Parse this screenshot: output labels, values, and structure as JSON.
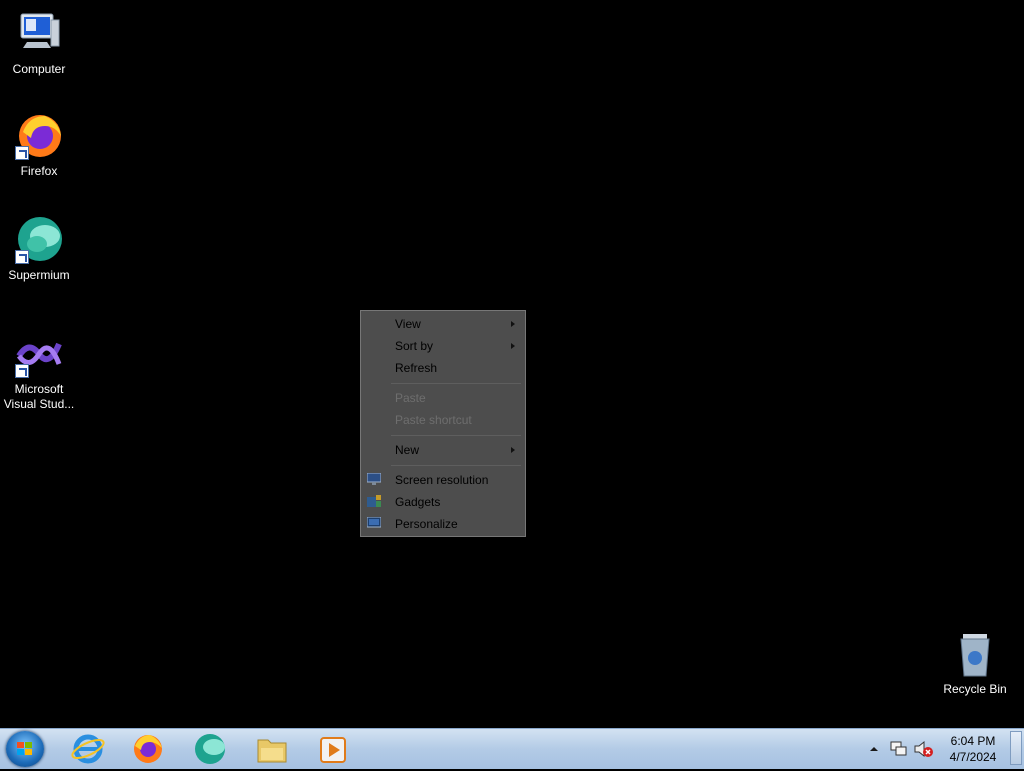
{
  "desktop": {
    "icons": [
      {
        "label": "Computer",
        "icon": "computer-icon"
      },
      {
        "label": "Firefox",
        "icon": "firefox-icon"
      },
      {
        "label": "Supermium",
        "icon": "supermium-icon"
      },
      {
        "label": "Microsoft Visual Stud...",
        "icon": "visual-studio-icon"
      },
      {
        "label": "Recycle Bin",
        "icon": "recycle-bin-icon"
      }
    ]
  },
  "context_menu": {
    "items": [
      {
        "label": "View",
        "submenu": true,
        "enabled": true
      },
      {
        "label": "Sort by",
        "submenu": true,
        "enabled": true
      },
      {
        "label": "Refresh",
        "submenu": false,
        "enabled": true
      },
      {
        "label": "Paste",
        "submenu": false,
        "enabled": false
      },
      {
        "label": "Paste shortcut",
        "submenu": false,
        "enabled": false
      },
      {
        "label": "New",
        "submenu": true,
        "enabled": true
      },
      {
        "label": "Screen resolution",
        "submenu": false,
        "enabled": true,
        "icon": "screen-resolution-icon"
      },
      {
        "label": "Gadgets",
        "submenu": false,
        "enabled": true,
        "icon": "gadgets-icon"
      },
      {
        "label": "Personalize",
        "submenu": false,
        "enabled": true,
        "icon": "personalize-icon"
      }
    ]
  },
  "taskbar": {
    "pinned": [
      "internet-explorer-icon",
      "firefox-icon",
      "supermium-icon",
      "file-explorer-icon",
      "media-player-icon"
    ],
    "tray_icons": [
      "show-hidden-icons-chevron",
      "network-icon",
      "volume-muted-icon"
    ],
    "clock": {
      "time": "6:04 PM",
      "date": "4/7/2024"
    }
  }
}
